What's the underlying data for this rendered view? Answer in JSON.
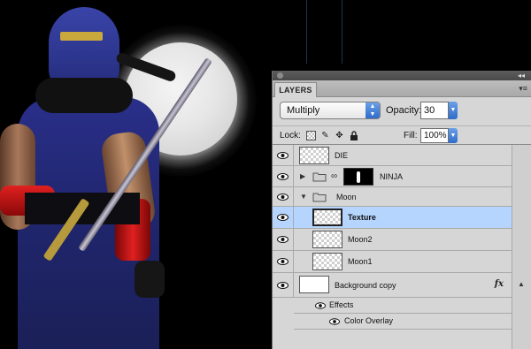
{
  "panel": {
    "tab_label": "LAYERS",
    "blend_mode": "Multiply",
    "opacity_label": "Opacity:",
    "opacity_value": "30",
    "lock_label": "Lock:",
    "fill_label": "Fill:",
    "fill_value": "100%"
  },
  "layers": [
    {
      "name": "DIE",
      "type": "layer",
      "visible": true
    },
    {
      "name": "NINJA",
      "type": "group-collapsed",
      "visible": true,
      "has_mask": true
    },
    {
      "name": "Moon",
      "type": "group-expanded",
      "visible": true
    },
    {
      "name": "Texture",
      "type": "layer",
      "visible": true,
      "selected": true
    },
    {
      "name": "Moon2",
      "type": "layer",
      "visible": true
    },
    {
      "name": "Moon1",
      "type": "layer",
      "visible": true
    },
    {
      "name": "Background copy",
      "type": "layer",
      "visible": true,
      "has_fx": true
    }
  ],
  "effects": {
    "header": "Effects",
    "items": [
      "Color Overlay"
    ]
  },
  "colors": {
    "selected_row": "#b5d5ff",
    "panel_bg": "#d6d6d6",
    "accent_blue": "#2f6cc9"
  }
}
